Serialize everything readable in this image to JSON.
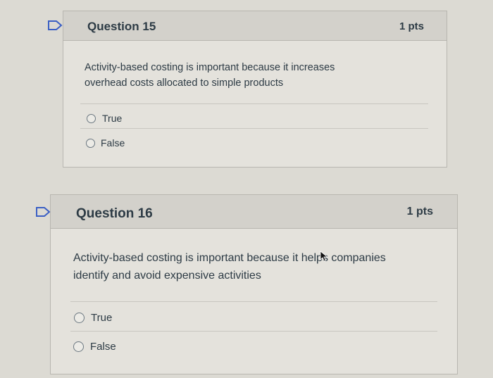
{
  "questions": [
    {
      "title": "Question 15",
      "points": "1 pts",
      "text_line1": "Activity-based costing is important because it increases",
      "text_line2": "overhead costs allocated to simple products",
      "answers": [
        "True",
        "False"
      ]
    },
    {
      "title": "Question 16",
      "points": "1 pts",
      "text_line1": "Activity-based costing is important because it helps companies",
      "text_line2": "identify and avoid expensive activities",
      "answers": [
        "True",
        "False"
      ]
    }
  ],
  "icons": {
    "flag": "flag-icon",
    "cursor": "mouse-cursor-icon"
  },
  "colors": {
    "flag": "#3b5fc4",
    "card_bg": "#e4e2dc",
    "header_bg": "#d3d1cb",
    "text": "#2d3b45"
  }
}
